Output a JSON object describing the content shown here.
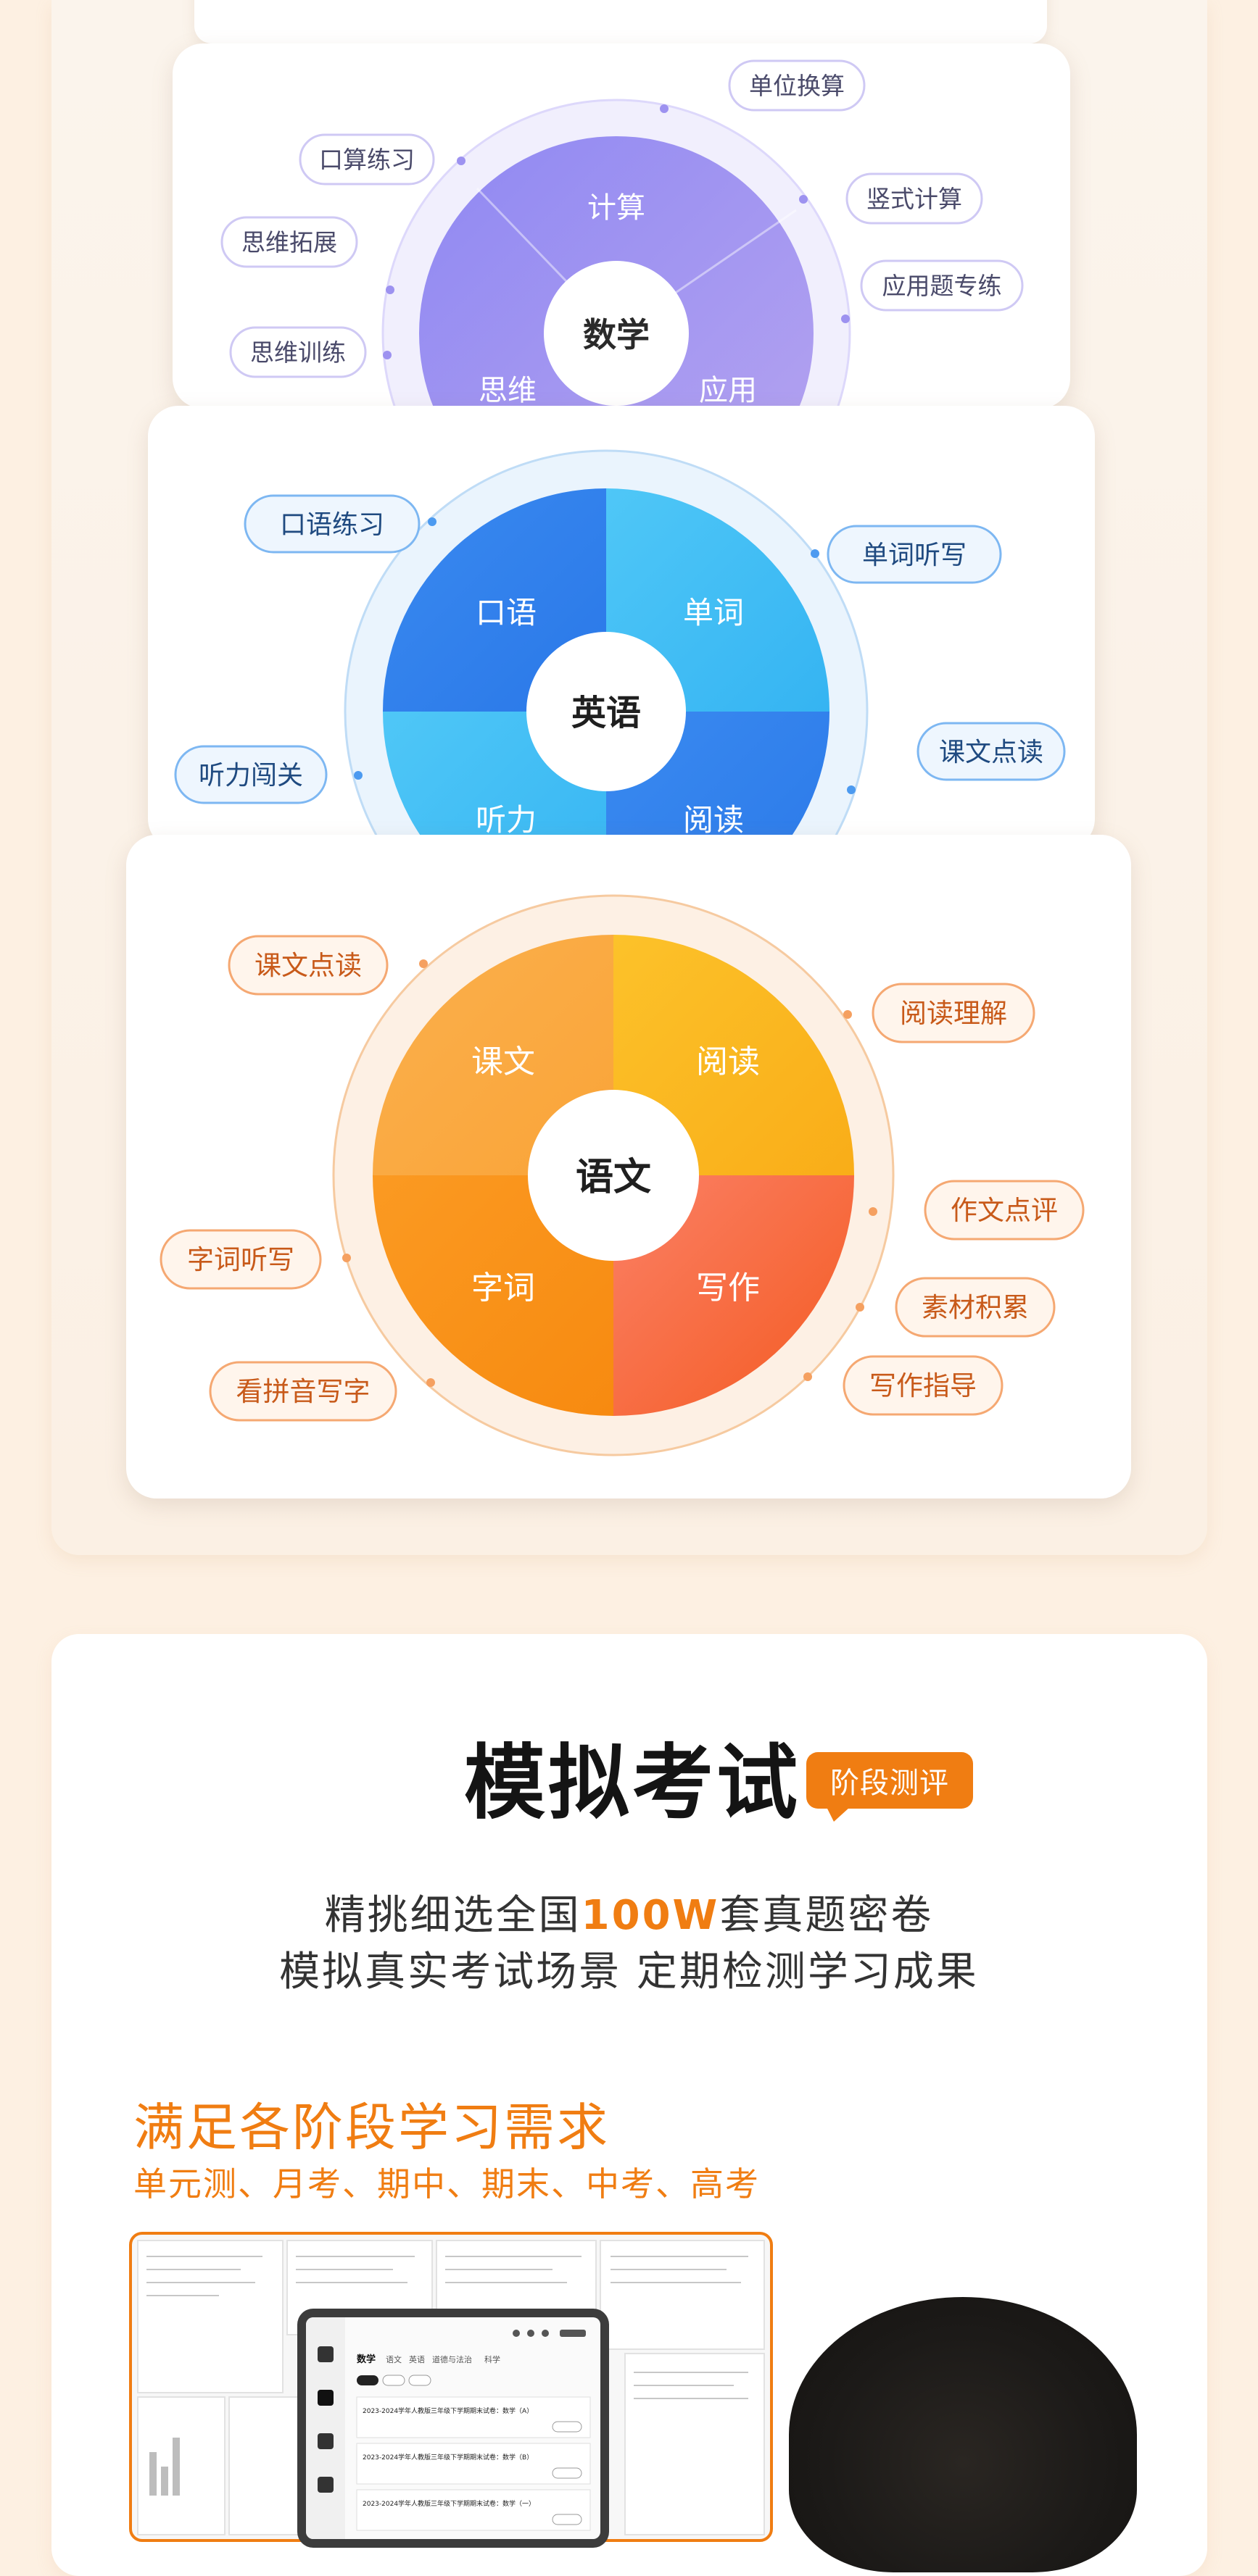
{
  "math": {
    "center": "数学",
    "segments": [
      "计算",
      "思维",
      "应用"
    ],
    "tags": [
      "单位换算",
      "口算练习",
      "竖式计算",
      "思维拓展",
      "应用题专练",
      "思维训练"
    ]
  },
  "english": {
    "center": "英语",
    "segments": [
      "口语",
      "单词",
      "听力",
      "阅读"
    ],
    "tags": [
      "口语练习",
      "单词听写",
      "课文点读",
      "听力闯关"
    ]
  },
  "chinese": {
    "center": "语文",
    "segments": [
      "课文",
      "阅读",
      "字词",
      "写作"
    ],
    "tags": [
      "课文点读",
      "阅读理解",
      "作文点评",
      "字词听写",
      "素材积累",
      "看拼音写字",
      "写作指导"
    ]
  },
  "exam": {
    "title": "模拟考试",
    "badge": "阶段测评",
    "desc1_prefix": "精挑细选全国",
    "desc1_highlight": "100W",
    "desc1_suffix": "套真题密卷",
    "desc2": "模拟真实考试场景 定期检测学习成果",
    "stage_title": "满足各阶段学习需求",
    "stage_sub": "单元测、月考、期中、期末、中考、高考"
  },
  "device": {
    "tabs": [
      "数学",
      "语文",
      "英语",
      "道德与法治",
      "科学"
    ],
    "items": [
      "2023-2024学年人教版三年级下学期期末试卷：数学（A）",
      "2023-2024学年人教版三年级下学期期末试卷：数学（B）",
      "2023-2024学年人教版三年级下学期期末试卷：数学（一）"
    ]
  },
  "colors": {
    "accent": "#f07d12",
    "math": "#9a8cf0",
    "english": "#2f8ef0",
    "chinese": "#fb9a1e"
  }
}
